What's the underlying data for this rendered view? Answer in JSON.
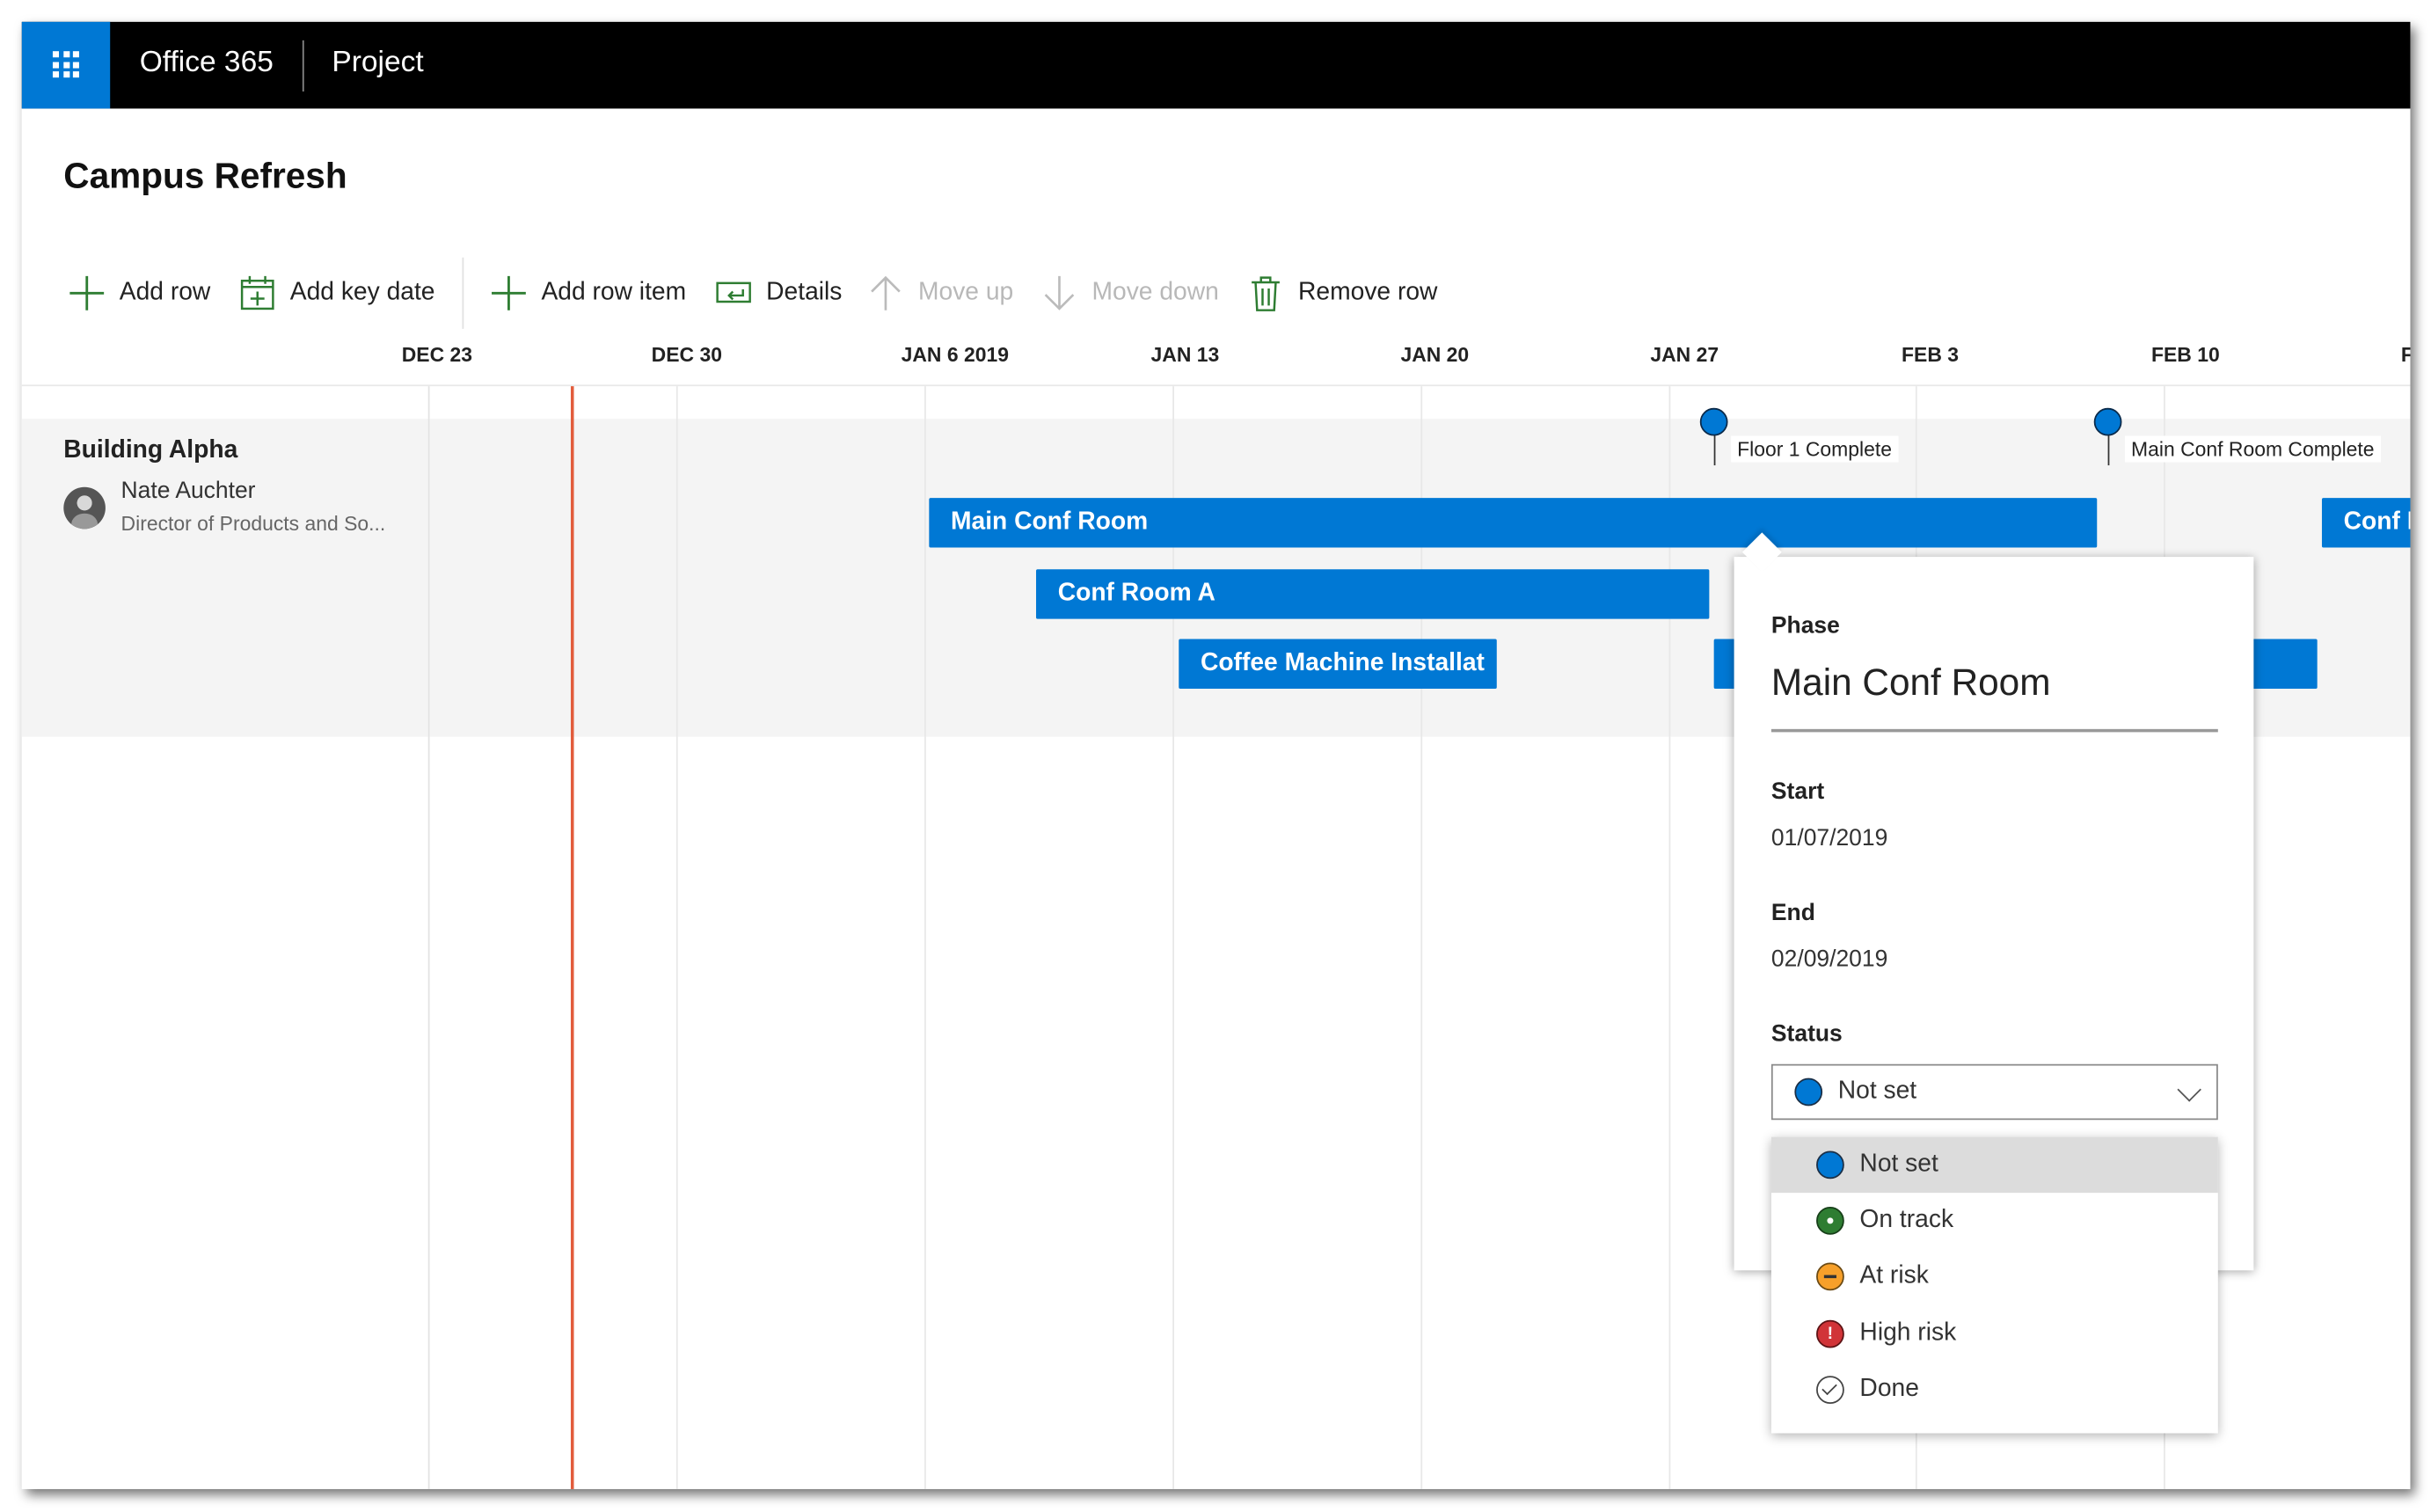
{
  "suite": {
    "brand": "Office 365",
    "app": "Project"
  },
  "project": {
    "title": "Campus Refresh"
  },
  "toolbar": {
    "add_row": "Add row",
    "add_key_date": "Add key date",
    "add_row_item": "Add row item",
    "details": "Details",
    "move_up": "Move up",
    "move_down": "Move down",
    "remove_row": "Remove row"
  },
  "timeline": {
    "dates": [
      "DEC 23",
      "DEC 30",
      "JAN 6 2019",
      "JAN 13",
      "JAN 20",
      "JAN 27",
      "FEB 3",
      "FEB 10",
      "F"
    ]
  },
  "row": {
    "name": "Building Alpha",
    "owner": "Nate Auchter",
    "owner_title": "Director of Products and So..."
  },
  "bars": [
    {
      "label": "Main Conf Room"
    },
    {
      "label": "Conf Room A"
    },
    {
      "label": "Coffee Machine Installat"
    },
    {
      "label": ""
    },
    {
      "label": "Conf R"
    }
  ],
  "key_dates": [
    {
      "label": "Floor 1 Complete"
    },
    {
      "label": "Main Conf Room Complete"
    }
  ],
  "details_panel": {
    "phase_label": "Phase",
    "phase_name": "Main Conf Room",
    "start_label": "Start",
    "start_value": "01/07/2019",
    "end_label": "End",
    "end_value": "02/09/2019",
    "status_label": "Status",
    "status_value": "Not set",
    "status_options": [
      {
        "label": "Not set",
        "icon": "blue-circle-icon",
        "color": "#0078d4"
      },
      {
        "label": "On track",
        "icon": "green-circle-icon",
        "color": "#2e7d32"
      },
      {
        "label": "At risk",
        "icon": "orange-circle-icon",
        "color": "#f7a02a"
      },
      {
        "label": "High risk",
        "icon": "red-alert-icon",
        "color": "#d13438"
      },
      {
        "label": "Done",
        "icon": "check-circle-icon",
        "color": "#444444"
      }
    ]
  },
  "colors": {
    "accent": "#0078d4",
    "today_line": "#e25c3c",
    "topbar": "#000000"
  }
}
